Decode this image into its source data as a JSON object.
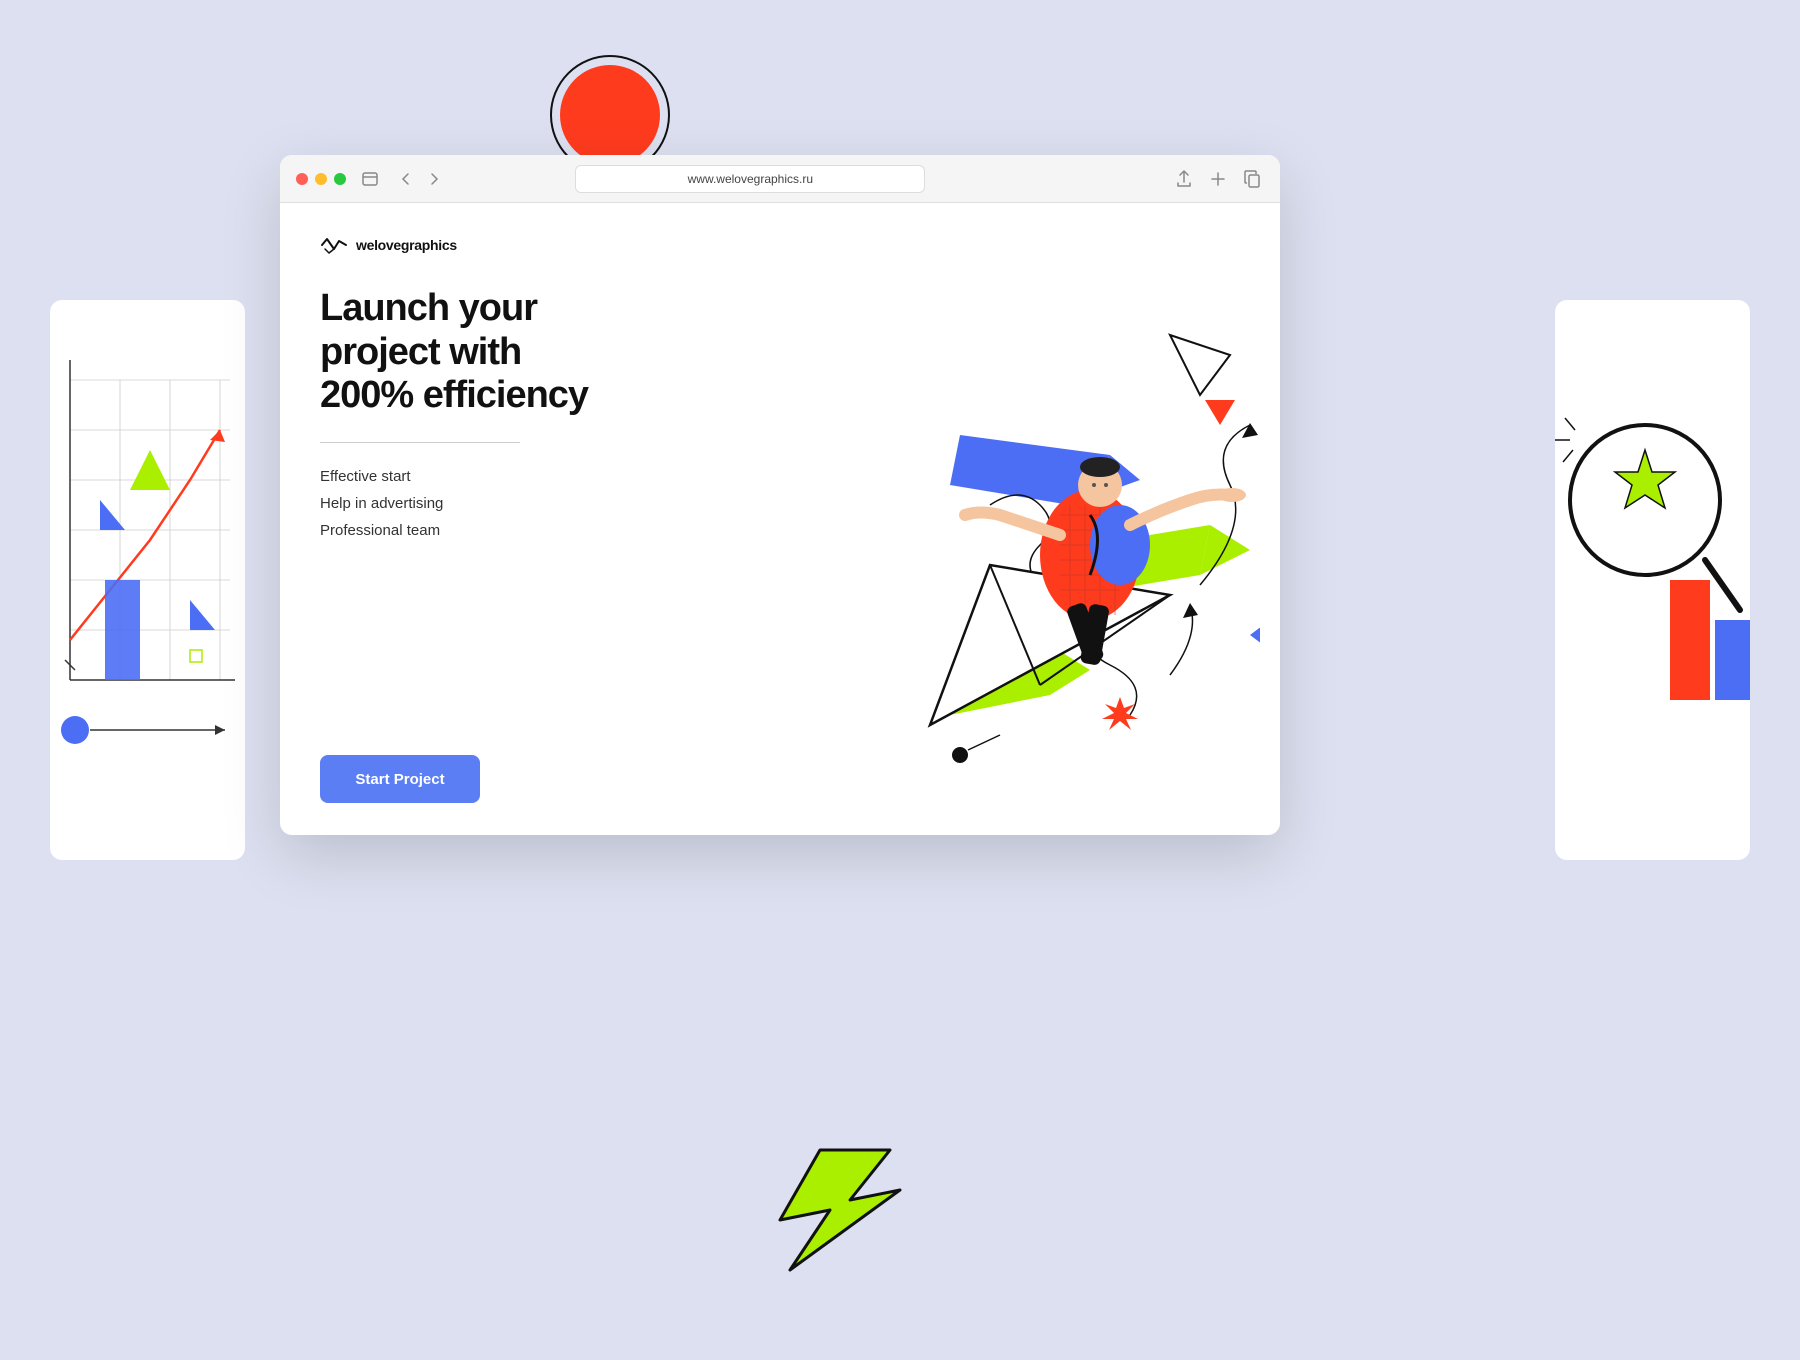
{
  "page": {
    "background_color": "#dce0f0",
    "title": "welovegraphics landing page"
  },
  "browser": {
    "url": "www.welovegraphics.ru",
    "window_controls": [
      "red",
      "yellow",
      "green"
    ]
  },
  "header": {
    "logo_text": "welovegraphics"
  },
  "hero": {
    "title": "Launch your project with 200% efficiency",
    "divider": true,
    "features": [
      "Effective start",
      "Help in advertising",
      "Professional team"
    ],
    "cta_label": "Start Project"
  },
  "colors": {
    "red": "#ff3b1e",
    "blue": "#4b6ef5",
    "green": "#aaee00",
    "black": "#111111",
    "white": "#ffffff",
    "accent_blue_btn": "#5b7ef5"
  }
}
